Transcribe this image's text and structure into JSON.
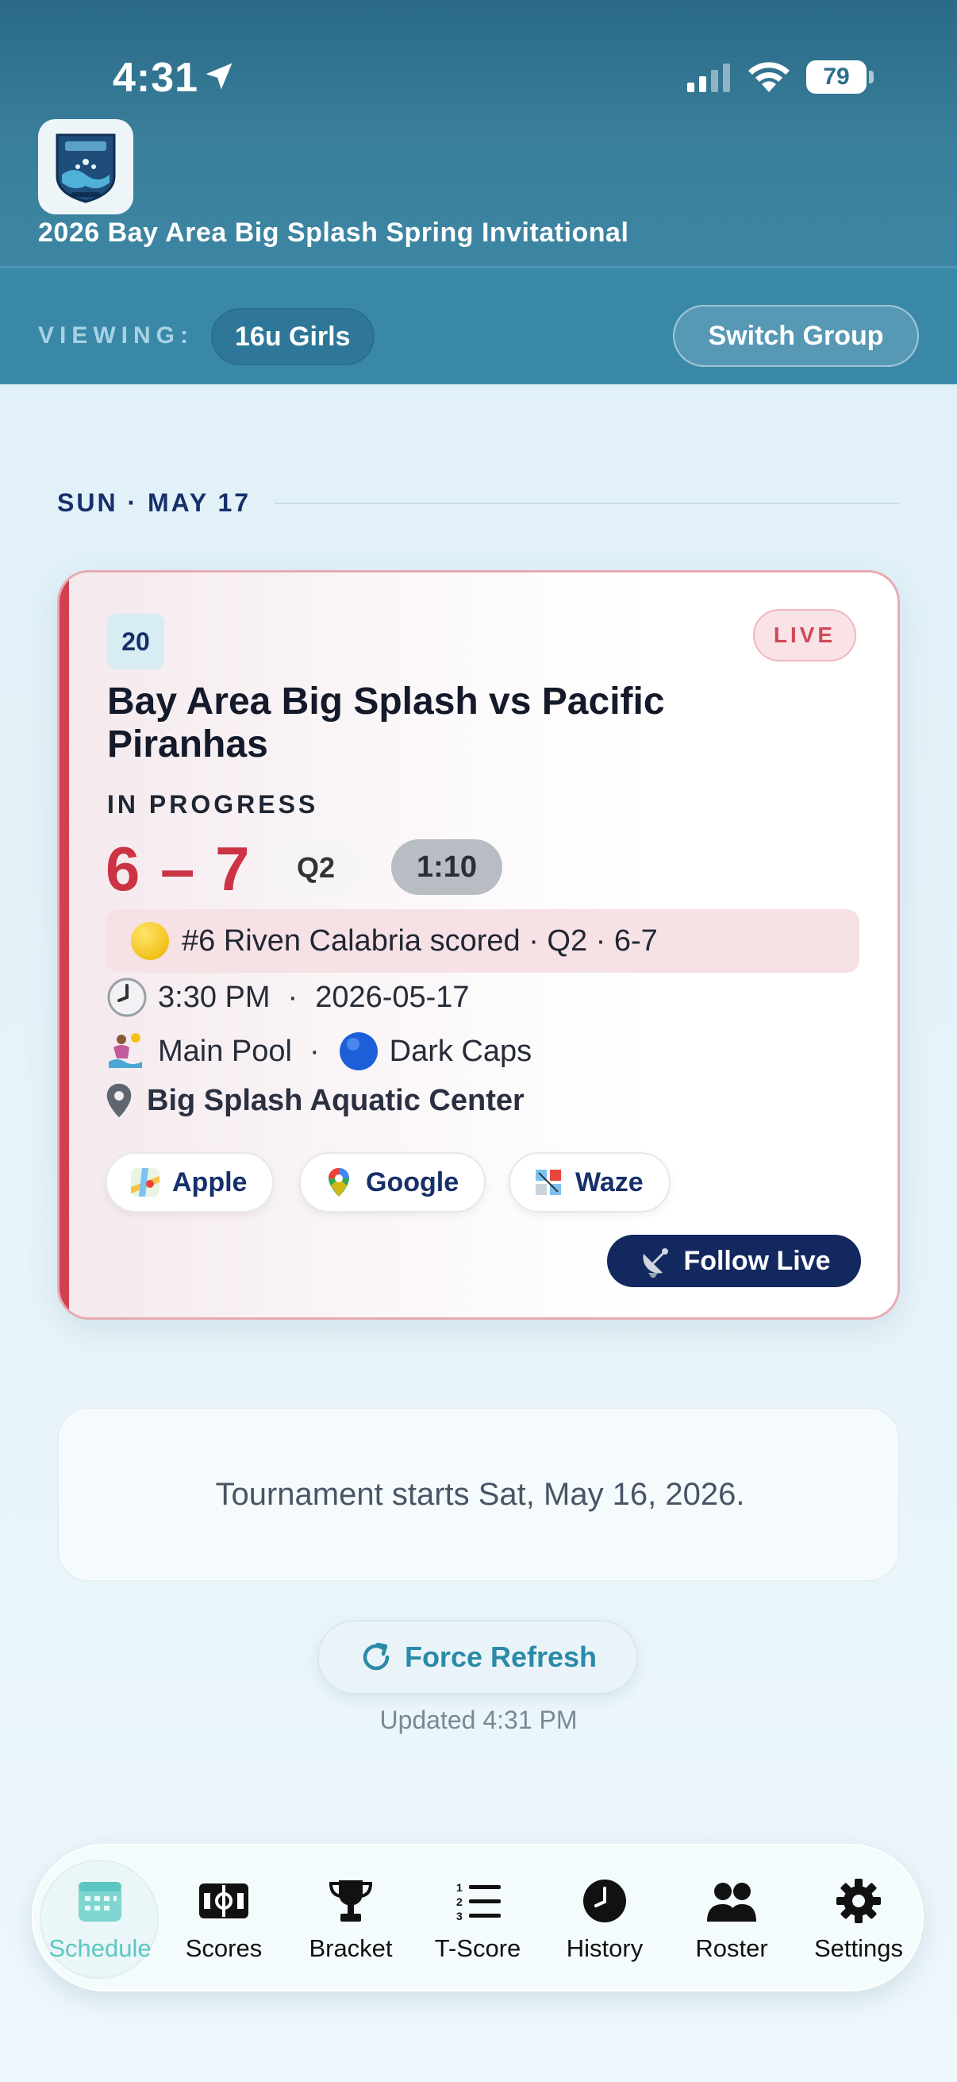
{
  "status_bar": {
    "time": "4:31",
    "battery": "79"
  },
  "header": {
    "app_title": "2026 Bay Area Big Splash Spring Invitational",
    "viewing_label": "VIEWING:",
    "group": "16u Girls",
    "switch_button": "Switch Group"
  },
  "schedule": {
    "date_heading": "SUN · MAY 17",
    "game": {
      "number": "20",
      "live_badge": "LIVE",
      "matchup": "Bay Area Big Splash vs Pacific Piranhas",
      "status": "IN PROGRESS",
      "score": "6 – 7",
      "period": "Q2",
      "clock": "1:10",
      "last_event": "#6 Riven Calabria scored · Q2 · 6-7",
      "time": "3:30 PM",
      "date": "2026-05-17",
      "time_separator": "·",
      "pool": "Main Pool",
      "pool_separator": "·",
      "caps": "Dark Caps",
      "venue": "Big Splash Aquatic Center",
      "map_buttons": [
        "Apple",
        "Google",
        "Waze"
      ],
      "follow_button": "Follow Live"
    },
    "info_message": "Tournament starts Sat, May 16, 2026.",
    "refresh_button": "Force Refresh",
    "updated_text": "Updated 4:31 PM"
  },
  "tabbar": {
    "tabs": [
      {
        "label": "Schedule",
        "icon": "calendar-icon",
        "active": true
      },
      {
        "label": "Scores",
        "icon": "scoreboard-icon",
        "active": false
      },
      {
        "label": "Bracket",
        "icon": "trophy-icon",
        "active": false
      },
      {
        "label": "T-Score",
        "icon": "numbered-list-icon",
        "active": false
      },
      {
        "label": "History",
        "icon": "clock-icon",
        "active": false
      },
      {
        "label": "Roster",
        "icon": "people-icon",
        "active": false
      },
      {
        "label": "Settings",
        "icon": "gear-icon",
        "active": false
      }
    ]
  },
  "colors": {
    "header": "#2e7090",
    "live_red": "#cc3344",
    "navy": "#13285e",
    "accent_teal": "#5cc7c1"
  }
}
